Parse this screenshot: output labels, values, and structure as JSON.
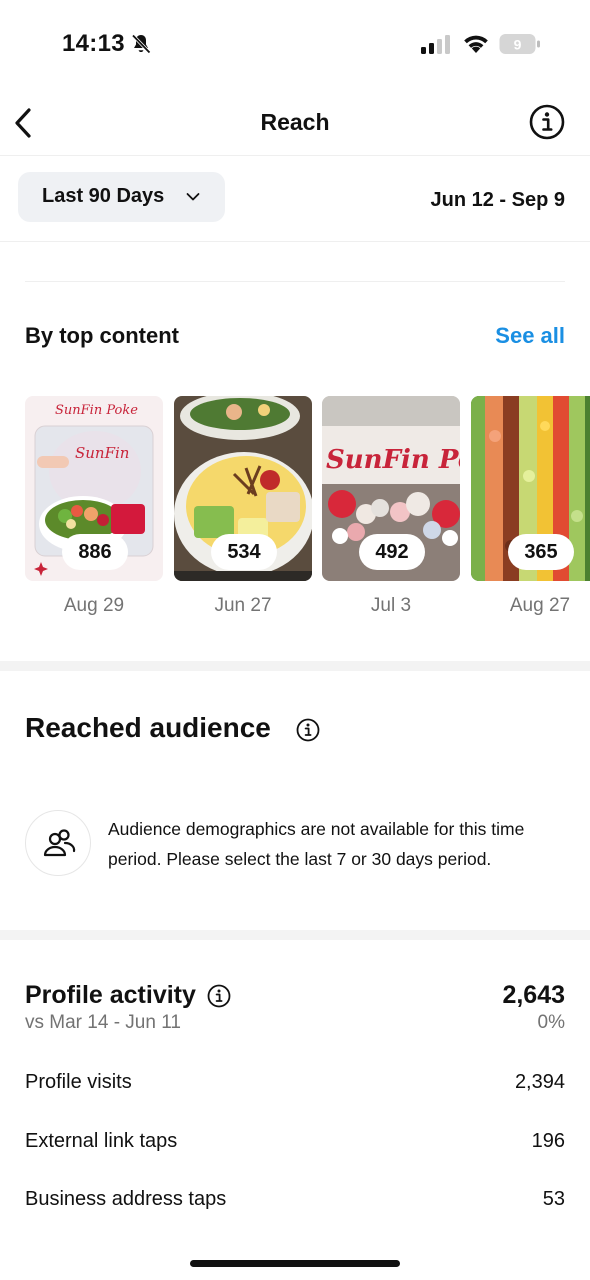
{
  "status_bar": {
    "time": "14:13",
    "battery_level": "9",
    "icons": [
      "bell-slash-icon",
      "cellular-signal-icon",
      "wifi-icon",
      "battery-icon"
    ]
  },
  "nav": {
    "title": "Reach",
    "icons": [
      "chevron-left-icon",
      "info-icon"
    ]
  },
  "filter": {
    "period_label": "Last 90 Days",
    "date_range": "Jun 12 - Sep 9"
  },
  "top_content": {
    "title": "By top content",
    "see_all": "See all",
    "items": [
      {
        "count": "886",
        "date": "Aug 29",
        "brand_script": "SunFin Poke"
      },
      {
        "count": "534",
        "date": "Jun 27"
      },
      {
        "count": "492",
        "date": "Jul 3",
        "brand_script": "SunFin Poke"
      },
      {
        "count": "365",
        "date": "Aug 27"
      }
    ]
  },
  "reached_audience": {
    "title": "Reached audience",
    "message": "Audience demographics are not available for this time period. Please select the last 7 or 30 days period."
  },
  "profile_activity": {
    "title": "Profile activity",
    "total": "2,643",
    "comparison_period": "vs Mar 14 - Jun 11",
    "change": "0%",
    "metrics": [
      {
        "label": "Profile visits",
        "value": "2,394"
      },
      {
        "label": "External link taps",
        "value": "196"
      },
      {
        "label": "Business address taps",
        "value": "53"
      }
    ]
  },
  "colors": {
    "link_blue": "#1a8fe3",
    "muted_text": "#737373",
    "pill_bg": "#eff1f4",
    "brand_red": "#c8243a"
  }
}
